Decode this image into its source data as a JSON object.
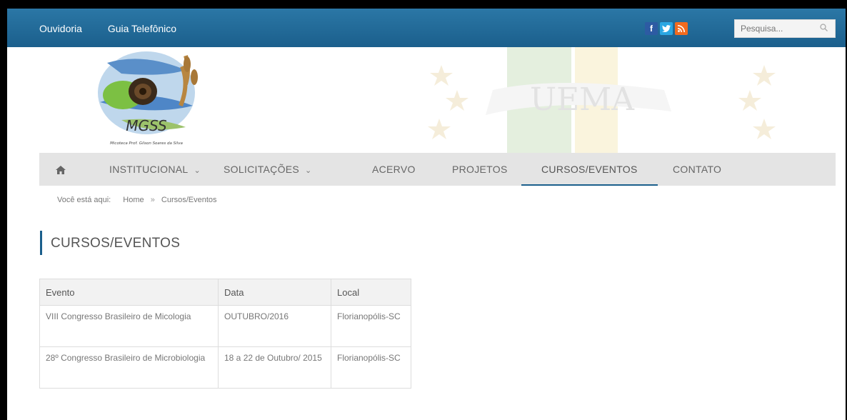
{
  "topbar": {
    "links": [
      "Ouvidoria",
      "Guia Telefônico"
    ],
    "social": [
      {
        "icon": "facebook-icon",
        "glyph": "f",
        "color": "#2d5ba3"
      },
      {
        "icon": "twitter-icon",
        "glyph": "t",
        "color": "#2aa7e3"
      },
      {
        "icon": "rss-icon",
        "glyph": "◢",
        "color": "#f26b1f"
      }
    ],
    "search_placeholder": "Pesquisa..."
  },
  "logo": {
    "text": "MGSS",
    "subtitle": "Micoteca Prof. Gilson Soares da Silva"
  },
  "watermark": {
    "text": "UEMA"
  },
  "nav": {
    "items": [
      {
        "label": "INSTITUCIONAL",
        "dropdown": true
      },
      {
        "label": "SOLICITAÇÕES",
        "dropdown": true
      },
      {
        "label": "ACERVO"
      },
      {
        "label": "PROJETOS"
      },
      {
        "label": "CURSOS/EVENTOS",
        "active": true
      },
      {
        "label": "CONTATO"
      }
    ]
  },
  "breadcrumb": {
    "prefix": "Você está aqui:",
    "home": "Home",
    "separator": "»",
    "current": "Cursos/Eventos"
  },
  "page": {
    "title": "CURSOS/EVENTOS"
  },
  "events_table": {
    "headers": [
      "Evento",
      "Data",
      "Local"
    ],
    "rows": [
      [
        "VIII Congresso Brasileiro de Micologia",
        "OUTUBRO/2016",
        "Florianopólis-SC"
      ],
      [
        "28º Congresso Brasileiro de Microbiologia",
        "18 a 22 de Outubro/ 2015",
        "Florianopólis-SC"
      ]
    ]
  },
  "colors": {
    "topbar": "#1b5f8c",
    "nav_bg": "#e4e4e4",
    "accent": "#1b5f8c"
  }
}
